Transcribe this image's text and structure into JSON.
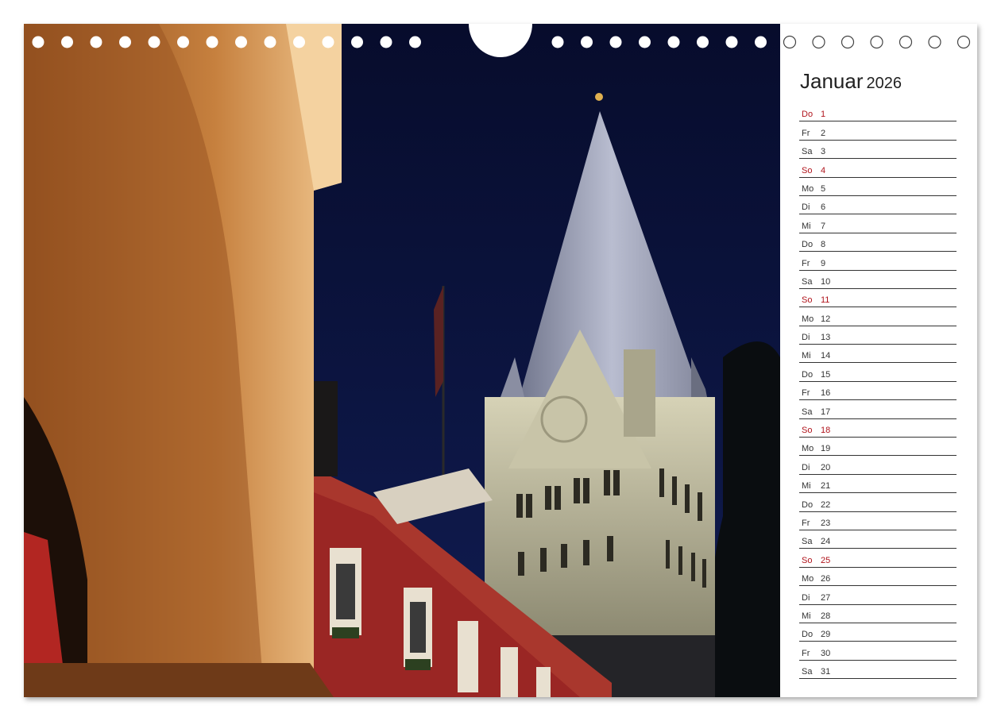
{
  "calendar": {
    "month": "Januar",
    "year": "2026",
    "days": [
      {
        "wd": "Do",
        "num": "1",
        "sun": true
      },
      {
        "wd": "Fr",
        "num": "2"
      },
      {
        "wd": "Sa",
        "num": "3"
      },
      {
        "wd": "So",
        "num": "4",
        "sun": true
      },
      {
        "wd": "Mo",
        "num": "5"
      },
      {
        "wd": "Di",
        "num": "6"
      },
      {
        "wd": "Mi",
        "num": "7"
      },
      {
        "wd": "Do",
        "num": "8"
      },
      {
        "wd": "Fr",
        "num": "9"
      },
      {
        "wd": "Sa",
        "num": "10"
      },
      {
        "wd": "So",
        "num": "11",
        "sun": true
      },
      {
        "wd": "Mo",
        "num": "12"
      },
      {
        "wd": "Di",
        "num": "13"
      },
      {
        "wd": "Mi",
        "num": "14"
      },
      {
        "wd": "Do",
        "num": "15"
      },
      {
        "wd": "Fr",
        "num": "16"
      },
      {
        "wd": "Sa",
        "num": "17"
      },
      {
        "wd": "So",
        "num": "18",
        "sun": true
      },
      {
        "wd": "Mo",
        "num": "19"
      },
      {
        "wd": "Di",
        "num": "20"
      },
      {
        "wd": "Mi",
        "num": "21"
      },
      {
        "wd": "Do",
        "num": "22"
      },
      {
        "wd": "Fr",
        "num": "23"
      },
      {
        "wd": "Sa",
        "num": "24"
      },
      {
        "wd": "So",
        "num": "25",
        "sun": true
      },
      {
        "wd": "Mo",
        "num": "26"
      },
      {
        "wd": "Di",
        "num": "27"
      },
      {
        "wd": "Mi",
        "num": "28"
      },
      {
        "wd": "Do",
        "num": "29"
      },
      {
        "wd": "Fr",
        "num": "30"
      },
      {
        "wd": "Sa",
        "num": "31"
      }
    ]
  },
  "colors": {
    "sunday": "#b0141c",
    "sky": "#0b1440",
    "arch": "#e4a86a",
    "building": "#a82a28",
    "tower_stone": "#b8b49a"
  },
  "photo": {
    "subject": "church-tower-night-photo"
  }
}
